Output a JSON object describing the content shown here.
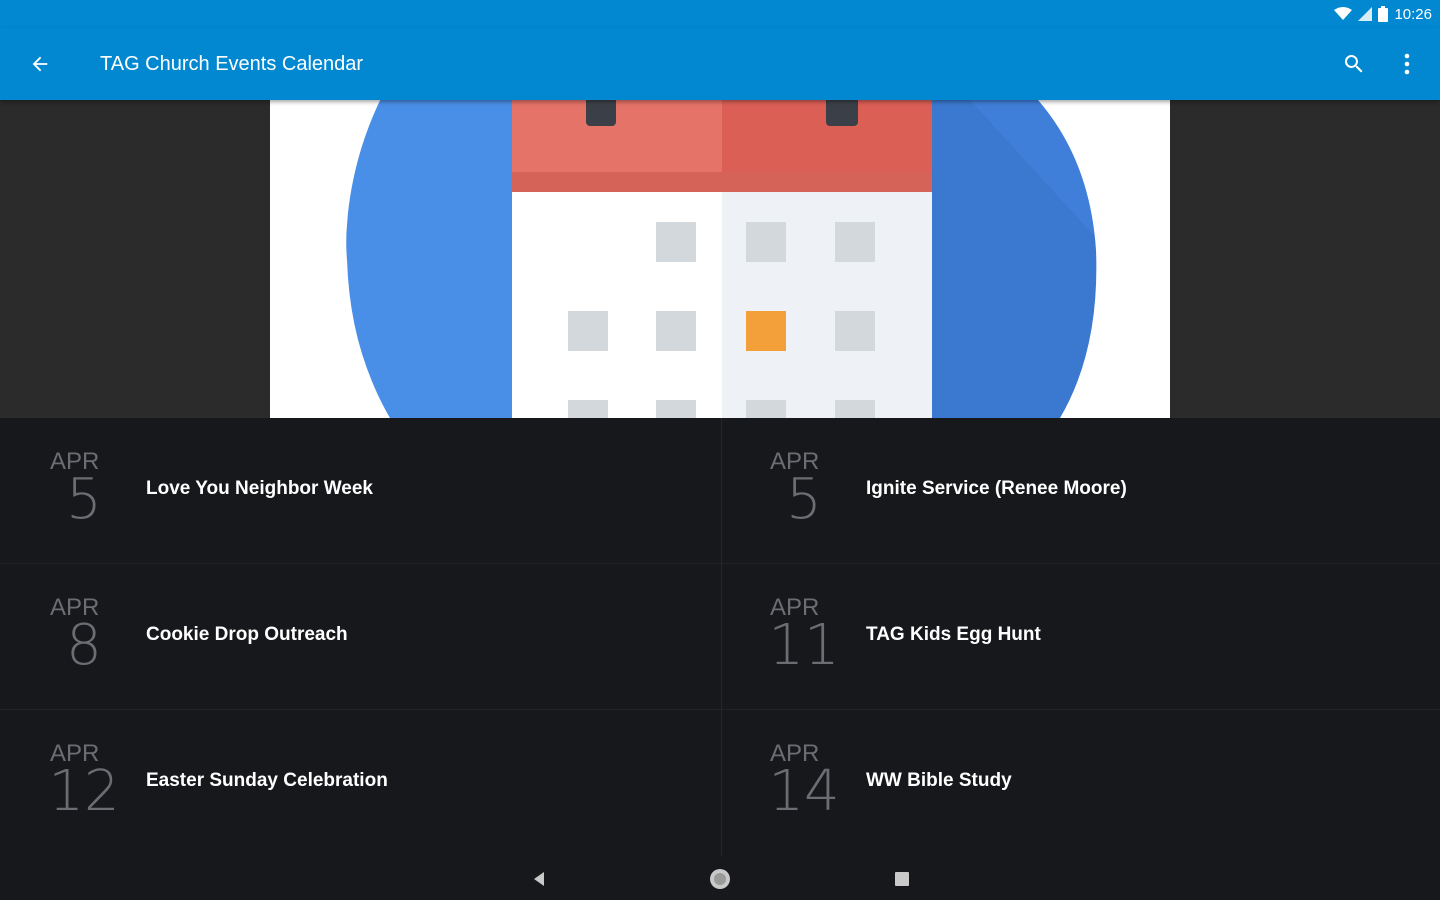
{
  "status_bar": {
    "time": "10:26"
  },
  "toolbar": {
    "title": "TAG Church Events Calendar"
  },
  "events": [
    {
      "month": "APR",
      "day": "5",
      "title": "Love You Neighbor Week"
    },
    {
      "month": "APR",
      "day": "5",
      "title": "Ignite Service (Renee Moore)"
    },
    {
      "month": "APR",
      "day": "8",
      "title": "Cookie Drop Outreach"
    },
    {
      "month": "APR",
      "day": "11",
      "title": "TAG Kids Egg Hunt"
    },
    {
      "month": "APR",
      "day": "12",
      "title": "Easter Sunday Celebration"
    },
    {
      "month": "APR",
      "day": "14",
      "title": "WW Bible Study"
    }
  ],
  "colors": {
    "primary": "#0288d1",
    "circle_blue": "#4a8fe7",
    "calendar_red": "#e57368",
    "highlight_orange": "#f4a03a"
  },
  "icons": {
    "back": "arrow-left-icon",
    "search": "search-icon",
    "more": "more-vert-icon"
  }
}
